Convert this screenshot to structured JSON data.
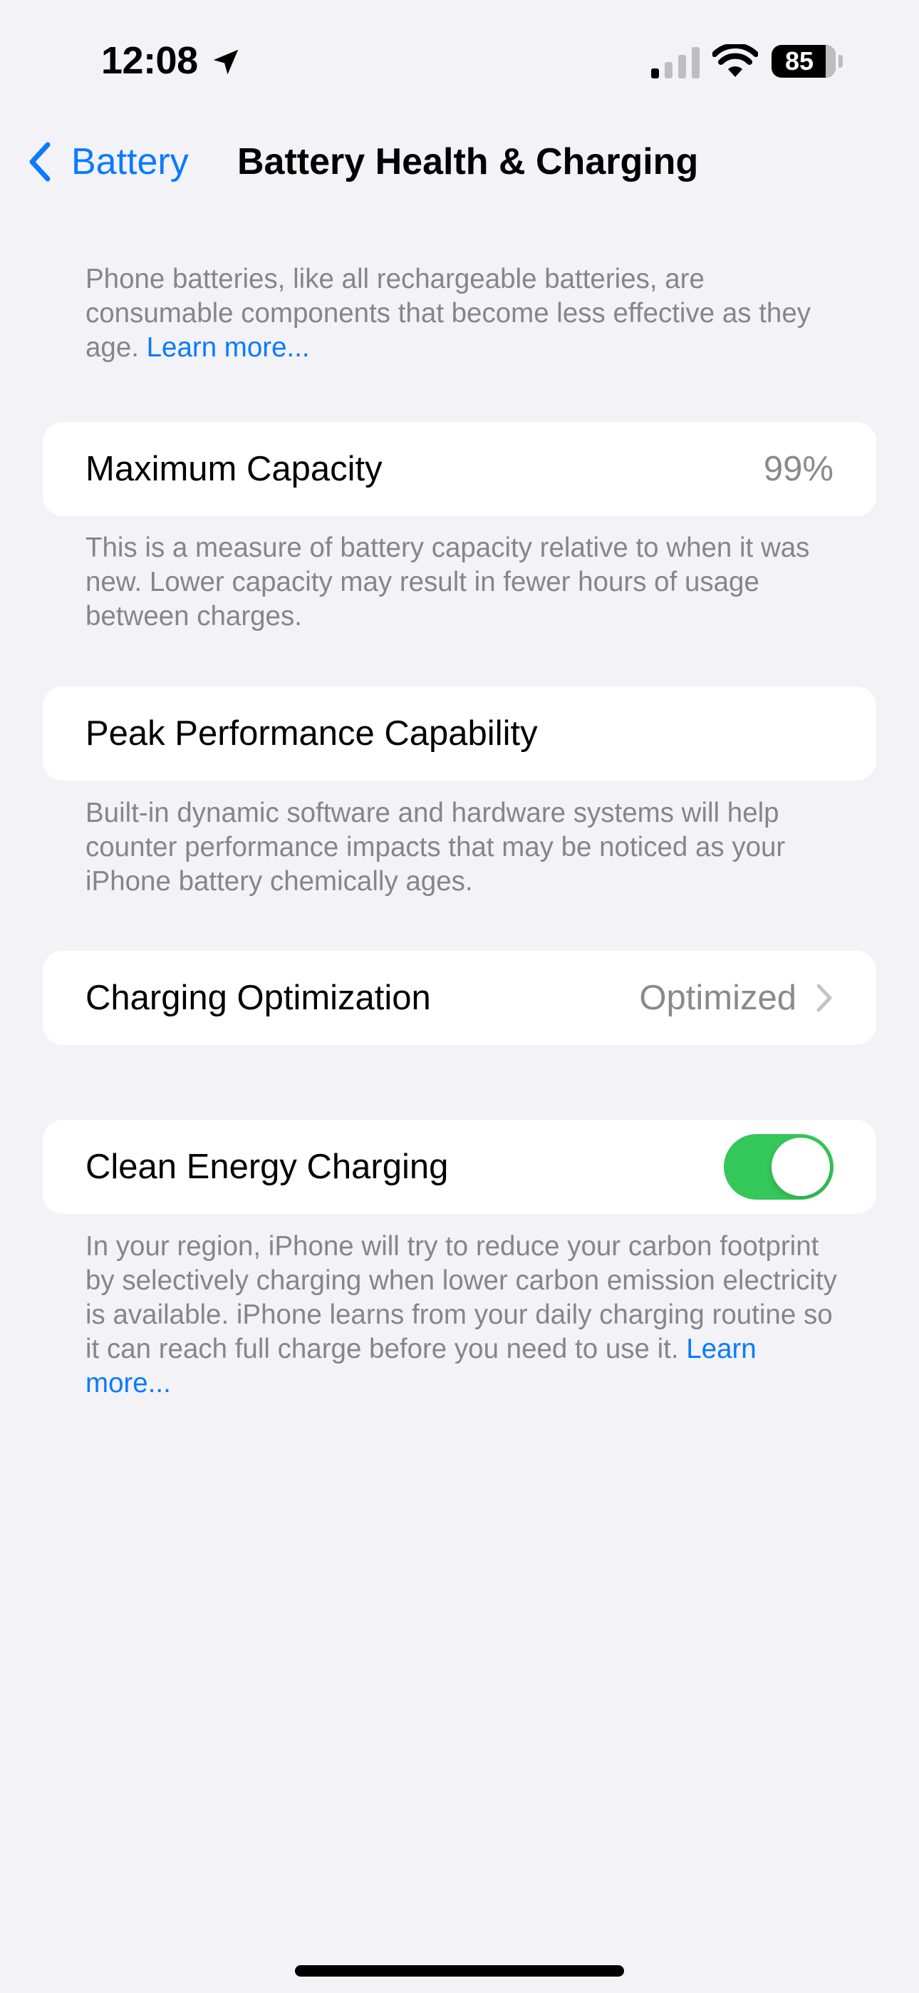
{
  "status_bar": {
    "time": "12:08",
    "battery_level": "85",
    "battery_fraction": 0.85,
    "icons": [
      "location-arrow-icon",
      "cellular-signal-icon",
      "wifi-icon",
      "battery-icon"
    ]
  },
  "nav": {
    "back_label": "Battery",
    "title": "Battery Health & Charging"
  },
  "intro": {
    "text": "Phone batteries, like all rechargeable batteries, are consumable components that become less effective as they age.",
    "link": "Learn more..."
  },
  "max_capacity": {
    "label": "Maximum Capacity",
    "value": "99%",
    "footnote": "This is a measure of battery capacity relative to when it was new. Lower capacity may result in fewer hours of usage between charges."
  },
  "peak_performance": {
    "label": "Peak Performance Capability",
    "footnote": "Built-in dynamic software and hardware systems will help counter performance impacts that may be noticed as your iPhone battery chemically ages."
  },
  "charging_optimization": {
    "label": "Charging Optimization",
    "value": "Optimized"
  },
  "clean_energy": {
    "label": "Clean Energy Charging",
    "enabled": true,
    "footnote": "In your region, iPhone will try to reduce your carbon footprint by selectively charging when lower carbon emission electricity is available. iPhone learns from your daily charging routine so it can reach full charge before you need to use it.",
    "link": "Learn more..."
  },
  "colors": {
    "background": "#F2F2F7",
    "card": "#FFFFFF",
    "accent": "#0A7AFF",
    "toggle_on": "#34C759",
    "secondary_text": "#85858B"
  }
}
